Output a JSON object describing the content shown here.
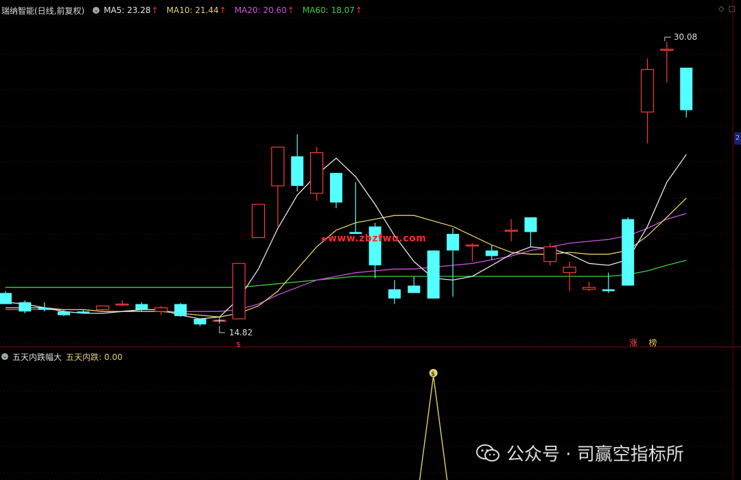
{
  "header": {
    "stock_title": "瑞纳智能(日线,前复权)",
    "ma": [
      {
        "label": "MA5: 23.28",
        "color": "#e8e8e8"
      },
      {
        "label": "MA10: 21.44",
        "color": "#e6d06a"
      },
      {
        "label": "MA20: 20.60",
        "color": "#d050e0"
      },
      {
        "label": "MA60: 18.07",
        "color": "#40d040"
      }
    ],
    "arrow": "↑"
  },
  "indicator_header": {
    "name": "五天内跌幅大",
    "value_label": "五天内跌: 0.00"
  },
  "right_tag": "2",
  "watermark": "www.zbzfwu.com",
  "wechat_label": "公众号 · 司赢空指标所",
  "colors": {
    "up": "#ff3b3b",
    "down": "#54ffff",
    "ma5": "#e8e8e8",
    "ma10": "#e6d06a",
    "ma20": "#d050e0",
    "ma60": "#40d040",
    "grid": "#3a0000",
    "indicator": "#e6d06a"
  },
  "chart_data": {
    "type": "candlestick",
    "price_range": [
      13.6,
      31.2
    ],
    "candles": [
      {
        "o": 16.3,
        "h": 16.4,
        "l": 15.7,
        "c": 15.7
      },
      {
        "o": 15.8,
        "h": 15.9,
        "l": 15.2,
        "c": 15.3
      },
      {
        "o": 15.5,
        "h": 15.8,
        "l": 15.3,
        "c": 15.4
      },
      {
        "o": 15.3,
        "h": 15.4,
        "l": 15.05,
        "c": 15.1
      },
      {
        "o": 15.3,
        "h": 15.4,
        "l": 15.2,
        "c": 15.2
      },
      {
        "o": 15.4,
        "h": 15.6,
        "l": 15.3,
        "c": 15.6
      },
      {
        "o": 15.7,
        "h": 15.9,
        "l": 15.6,
        "c": 15.7
      },
      {
        "o": 15.7,
        "h": 15.8,
        "l": 15.3,
        "c": 15.4
      },
      {
        "o": 15.3,
        "h": 15.6,
        "l": 15.1,
        "c": 15.5
      },
      {
        "o": 15.7,
        "h": 15.75,
        "l": 15.0,
        "c": 15.05
      },
      {
        "o": 14.9,
        "h": 14.9,
        "l": 14.5,
        "c": 14.6
      },
      {
        "o": 14.82,
        "h": 14.82,
        "l": 14.82,
        "c": 14.82
      },
      {
        "o": 14.9,
        "h": 17.9,
        "l": 14.9,
        "c": 17.9
      },
      {
        "o": 19.3,
        "h": 21.1,
        "l": 19.3,
        "c": 21.1
      },
      {
        "o": 22.1,
        "h": 24.2,
        "l": 19.9,
        "c": 24.2
      },
      {
        "o": 23.7,
        "h": 24.9,
        "l": 21.8,
        "c": 22.1
      },
      {
        "o": 21.7,
        "h": 24.2,
        "l": 21.3,
        "c": 23.9
      },
      {
        "o": 22.8,
        "h": 22.6,
        "l": 20.9,
        "c": 21.2
      },
      {
        "o": 19.6,
        "h": 22.3,
        "l": 19.6,
        "c": 19.5
      },
      {
        "o": 19.9,
        "h": 20.1,
        "l": 17.1,
        "c": 17.8
      },
      {
        "o": 16.5,
        "h": 17.0,
        "l": 15.7,
        "c": 16.0
      },
      {
        "o": 16.7,
        "h": 17.2,
        "l": 16.4,
        "c": 16.3
      },
      {
        "o": 18.6,
        "h": 18.1,
        "l": 16.1,
        "c": 16.0
      },
      {
        "o": 19.5,
        "h": 19.8,
        "l": 16.1,
        "c": 18.6
      },
      {
        "o": 18.9,
        "h": 19.0,
        "l": 18.0,
        "c": 18.9
      },
      {
        "o": 18.6,
        "h": 18.9,
        "l": 18.1,
        "c": 18.3
      },
      {
        "o": 19.7,
        "h": 20.3,
        "l": 19.1,
        "c": 19.7
      },
      {
        "o": 20.4,
        "h": 20.4,
        "l": 18.8,
        "c": 19.6
      },
      {
        "o": 18.0,
        "h": 19.0,
        "l": 17.8,
        "c": 18.8
      },
      {
        "o": 17.4,
        "h": 18.0,
        "l": 16.4,
        "c": 17.7
      },
      {
        "o": 16.5,
        "h": 16.9,
        "l": 16.4,
        "c": 16.6
      },
      {
        "o": 16.5,
        "h": 17.4,
        "l": 16.3,
        "c": 16.4
      },
      {
        "o": 20.3,
        "h": 20.4,
        "l": 16.7,
        "c": 16.7
      },
      {
        "o": 26.1,
        "h": 29.0,
        "l": 24.4,
        "c": 28.4
      },
      {
        "o": 29.5,
        "h": 29.9,
        "l": 27.7,
        "c": 29.5
      },
      {
        "o": 28.5,
        "h": 27.8,
        "l": 25.8,
        "c": 26.2
      }
    ],
    "ma5": [
      15.8,
      15.7,
      15.5,
      15.3,
      15.2,
      15.2,
      15.3,
      15.4,
      15.4,
      15.1,
      14.9,
      15.0,
      16.0,
      17.6,
      19.8,
      21.6,
      22.7,
      23.6,
      22.6,
      21.1,
      19.4,
      18.0,
      17.1,
      17.0,
      17.2,
      17.8,
      18.4,
      18.8,
      18.7,
      18.4,
      17.9,
      17.8,
      18.1,
      19.9,
      22.3,
      23.8
    ],
    "ma10": [
      15.5,
      15.5,
      15.5,
      15.4,
      15.4,
      15.3,
      15.3,
      15.3,
      15.3,
      15.2,
      15.1,
      15.0,
      15.2,
      15.6,
      16.4,
      17.6,
      18.8,
      19.7,
      20.1,
      20.3,
      20.5,
      20.5,
      20.2,
      19.9,
      19.4,
      18.9,
      18.5,
      18.4,
      18.4,
      18.5,
      18.4,
      18.4,
      18.6,
      19.4,
      20.4,
      21.44
    ],
    "ma20": [
      15.4,
      15.4,
      15.4,
      15.4,
      15.4,
      15.3,
      15.3,
      15.3,
      15.3,
      15.3,
      15.3,
      15.3,
      15.4,
      15.7,
      16.2,
      16.6,
      17.0,
      17.2,
      17.4,
      17.5,
      17.6,
      17.6,
      17.7,
      17.8,
      17.9,
      18.1,
      18.3,
      18.6,
      18.8,
      19.0,
      19.1,
      19.2,
      19.4,
      19.8,
      20.3,
      20.6
    ],
    "ma60": [
      16.6,
      16.6,
      16.6,
      16.6,
      16.6,
      16.6,
      16.6,
      16.6,
      16.6,
      16.6,
      16.6,
      16.6,
      16.6,
      16.7,
      16.8,
      16.9,
      17.0,
      17.1,
      17.2,
      17.2,
      17.2,
      17.2,
      17.2,
      17.2,
      17.2,
      17.2,
      17.2,
      17.2,
      17.2,
      17.2,
      17.2,
      17.2,
      17.3,
      17.5,
      17.8,
      18.07
    ],
    "high_label": "30.08",
    "low_label": "14.82",
    "signal_labels": {
      "s_mark": "$",
      "zhang": "涨",
      "bang": "榜"
    },
    "indicator": {
      "spike_index": 22,
      "icon": "$"
    }
  }
}
